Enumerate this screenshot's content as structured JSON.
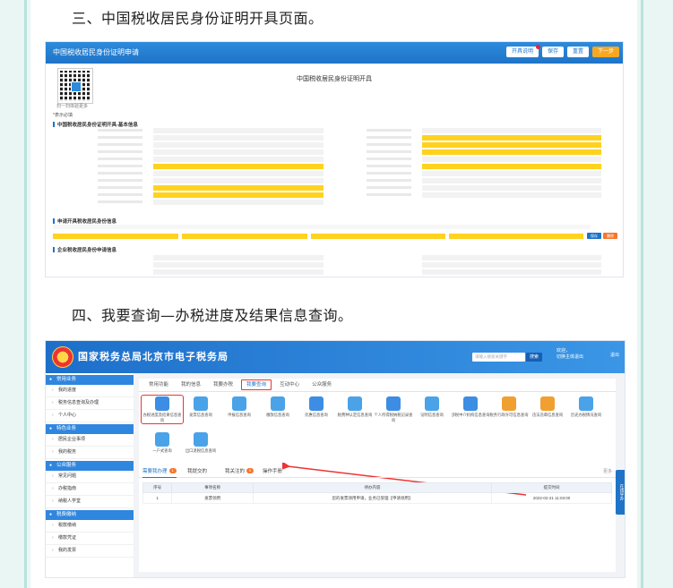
{
  "headings": {
    "section3": "三、中国税收居民身份证明开具页面。",
    "section4": "四、我要查询—办税进度及结果信息查询。"
  },
  "shot1": {
    "bar_title": "中国税收居民身份证明申请",
    "buttons": [
      "开具说明",
      "保存",
      "重置",
      "下一步"
    ],
    "qr_caption": "扫一扫体验更多",
    "page_title": "中国税收居民身份证明开具",
    "required_note": "*表示必填",
    "section_basic": "中国税收居民身份证明开具-基本信息",
    "section_applicant": "申请开具税收居民身份信息",
    "section_other": "企业税收居民身份申请信息",
    "op_buttons": [
      "保存",
      "删除"
    ],
    "colors": {
      "bar": "#1f74c8",
      "required_field": "#ffd21f",
      "next_button": "#f7a823"
    }
  },
  "shot2": {
    "site_title": "国家税务总局北京市电子税务局",
    "search_placeholder": "请输入搜索关键字",
    "search_button": "搜索",
    "user_line1": "欢迎，",
    "user_line2": "切换主体退出",
    "exit_label": "退出",
    "sidebar": [
      {
        "group": "常用业务",
        "items": [
          "我的进度",
          "税务信息查询及办理",
          "个人中心"
        ]
      },
      {
        "group": "特色业务",
        "items": [
          "居民企业事项",
          "我的税务"
        ]
      },
      {
        "group": "公众服务",
        "items": [
          "常见问题",
          "办税指南",
          "纳税人学堂"
        ]
      },
      {
        "group": "税费缴纳",
        "items": [
          "税款缴纳",
          "缴款凭证",
          "我的发票"
        ]
      }
    ],
    "top_tabs": [
      "常用功能",
      "我的信息",
      "我要办税",
      "我要查询",
      "互动中心",
      "公众服务"
    ],
    "active_tab": "我要查询",
    "icons": [
      "办税进度及结果信息查询",
      "发票信息查询",
      "申报信息查询",
      "缴款信息查询",
      "优惠信息查询",
      "税费种认定信息查询",
      "个人所得税纳税记录查询",
      "证明信息查询",
      "涉税中介机构信息查询",
      "税务行政许可信息查询",
      "违法违章信息查询",
      "历史办税情况查询",
      "一户式查询",
      "出口退税信息查询"
    ],
    "lower_tabs": [
      "需要我办理",
      "我提交的",
      "我关注的",
      "操作手册"
    ],
    "lower_badges": [
      "1",
      "",
      "0",
      ""
    ],
    "more_label": "更多",
    "table_headers": [
      "序号",
      "事项名称",
      "待办内容",
      "提交时间"
    ],
    "table_rows": [
      [
        "1",
        "发票领用",
        "您的发票领用申请，业务已受理【申请领用】",
        "2022-02-21 11:03:00"
      ]
    ],
    "float_label": "在线导办",
    "colors": {
      "header": "#1d6fc9",
      "highlight": "#e33333"
    }
  }
}
